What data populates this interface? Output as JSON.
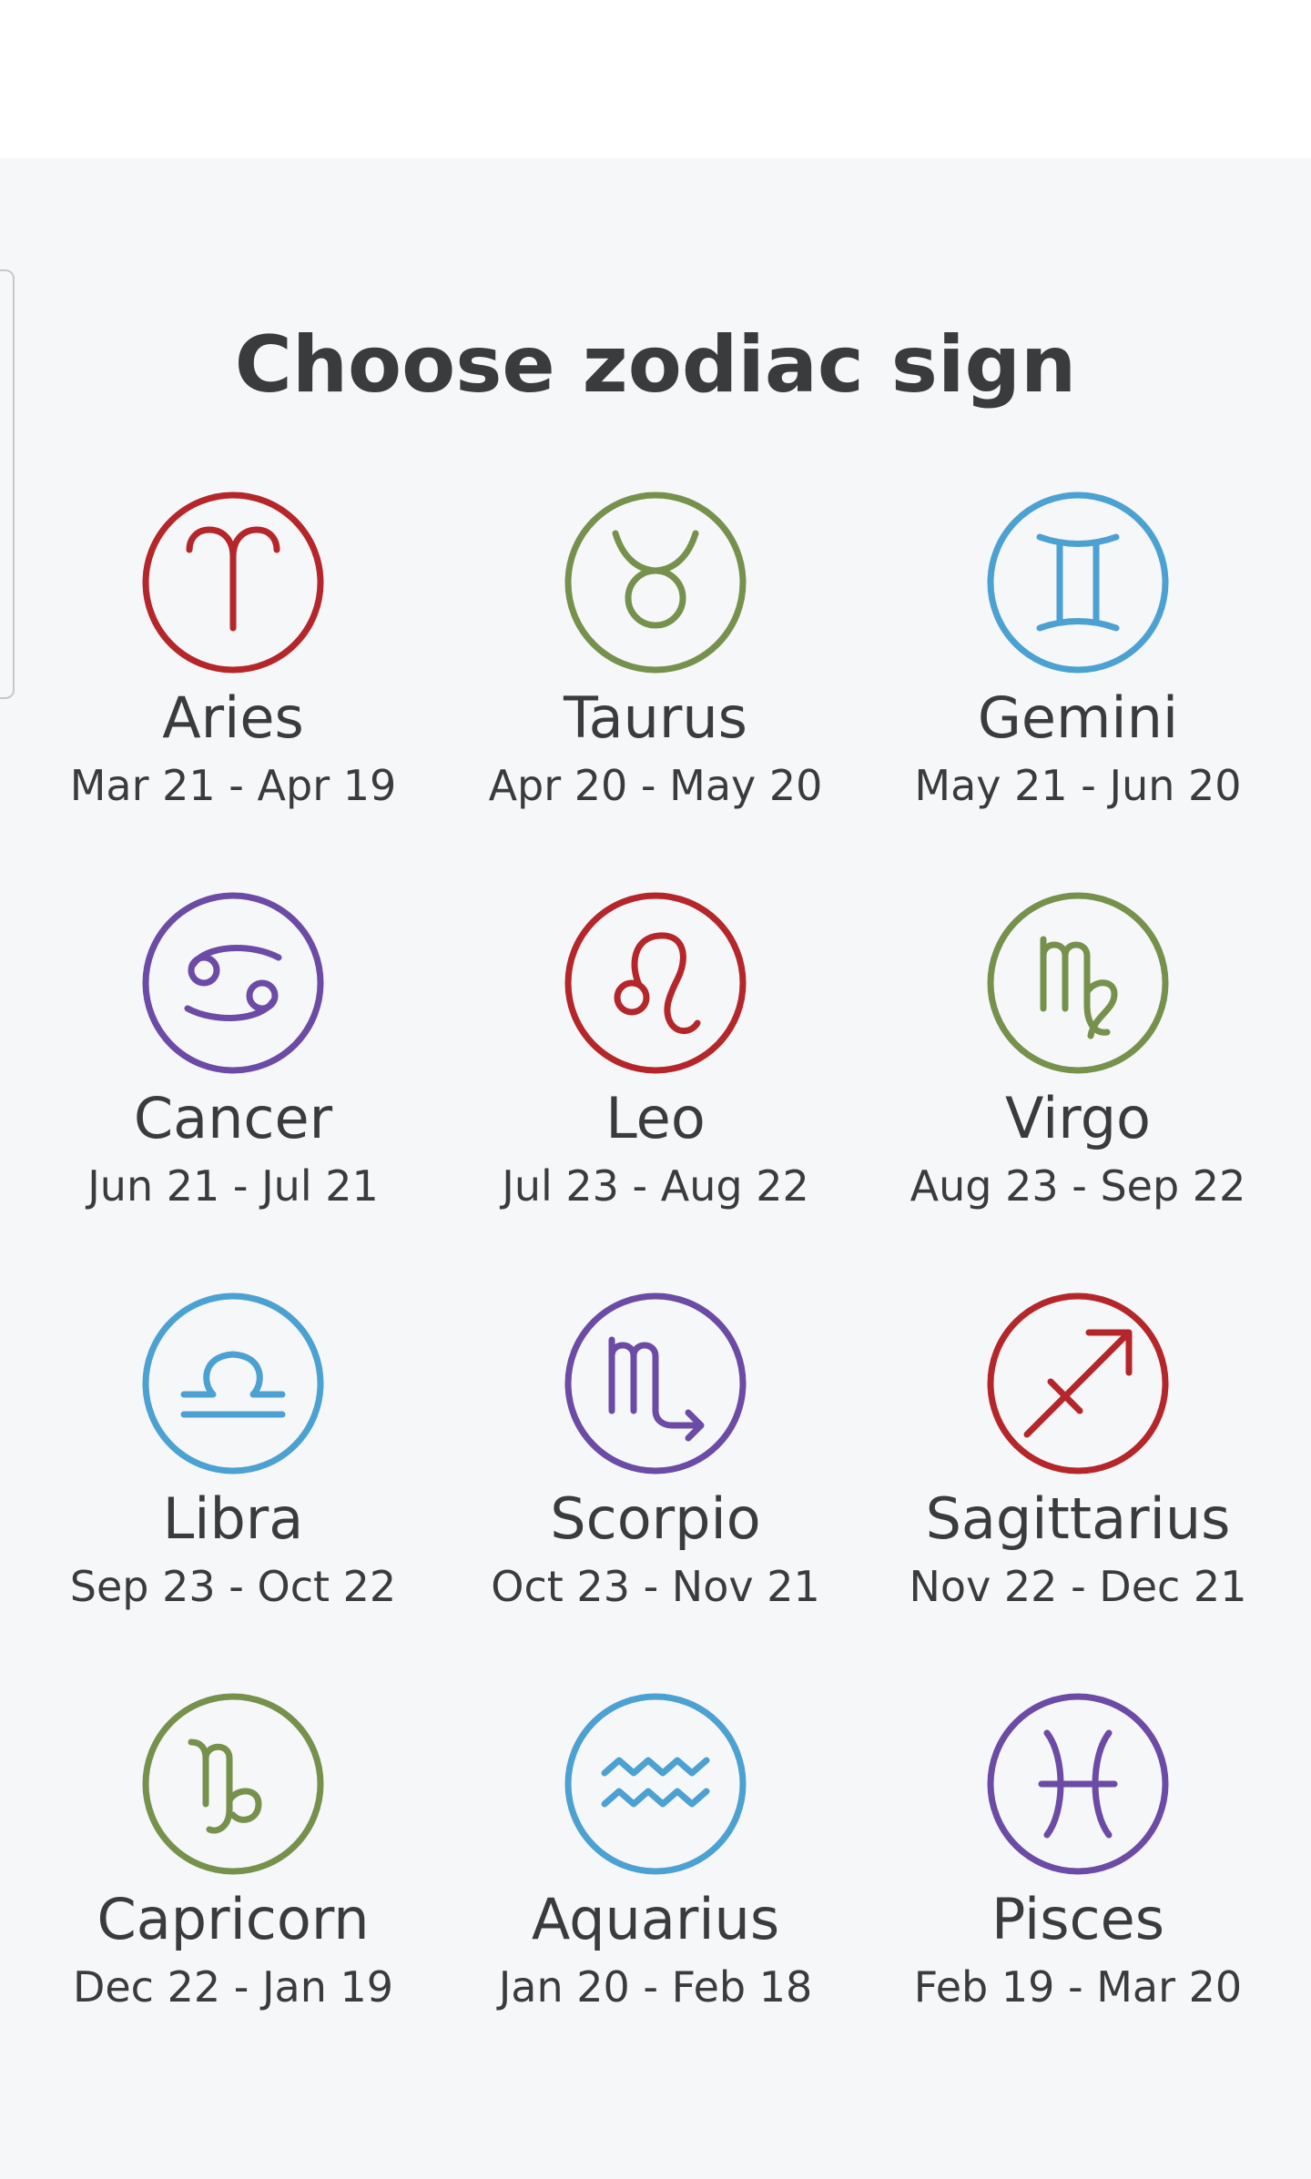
{
  "page": {
    "title": "Choose zodiac sign"
  },
  "colors": {
    "red": "#b5262a",
    "green": "#76914c",
    "blue": "#4aa1d2",
    "purple": "#6b4ba6",
    "text": "#3a3b3d",
    "panel_bg": "#f6f7f9"
  },
  "signs": [
    {
      "name": "Aries",
      "dates": "Mar 21 - Apr 19",
      "icon": "aries-icon",
      "color": "#b5262a"
    },
    {
      "name": "Taurus",
      "dates": "Apr 20 - May 20",
      "icon": "taurus-icon",
      "color": "#76914c"
    },
    {
      "name": "Gemini",
      "dates": "May 21 - Jun 20",
      "icon": "gemini-icon",
      "color": "#4aa1d2"
    },
    {
      "name": "Cancer",
      "dates": "Jun 21 - Jul 21",
      "icon": "cancer-icon",
      "color": "#6b4ba6"
    },
    {
      "name": "Leo",
      "dates": "Jul 23 - Aug 22",
      "icon": "leo-icon",
      "color": "#b5262a"
    },
    {
      "name": "Virgo",
      "dates": "Aug 23 - Sep 22",
      "icon": "virgo-icon",
      "color": "#76914c"
    },
    {
      "name": "Libra",
      "dates": "Sep 23 - Oct 22",
      "icon": "libra-icon",
      "color": "#4aa1d2"
    },
    {
      "name": "Scorpio",
      "dates": "Oct 23 - Nov 21",
      "icon": "scorpio-icon",
      "color": "#6b4ba6"
    },
    {
      "name": "Sagittarius",
      "dates": "Nov 22 - Dec 21",
      "icon": "sagittarius-icon",
      "color": "#b5262a"
    },
    {
      "name": "Capricorn",
      "dates": "Dec 22 - Jan 19",
      "icon": "capricorn-icon",
      "color": "#76914c"
    },
    {
      "name": "Aquarius",
      "dates": "Jan 20 - Feb 18",
      "icon": "aquarius-icon",
      "color": "#4aa1d2"
    },
    {
      "name": "Pisces",
      "dates": "Feb 19 - Mar 20",
      "icon": "pisces-icon",
      "color": "#6b4ba6"
    }
  ]
}
